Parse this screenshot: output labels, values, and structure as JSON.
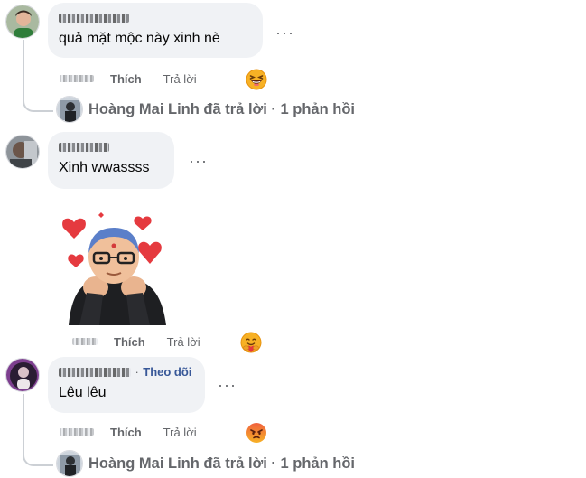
{
  "comments": [
    {
      "text": "quả mặt mộc này xinh nè",
      "more": "···",
      "like_label": "Thích",
      "reply_label": "Trả lời",
      "reaction_icon": "grinning-squint-emoji",
      "replies": {
        "author": "Hoàng Mai Linh",
        "summary": "đã trả lời · 1 phản hồi"
      }
    },
    {
      "text": "Xinh wwassss",
      "more": "···",
      "sticker": "bald-man-with-hearts-sticker",
      "like_label": "Thích",
      "reply_label": "Trả lời",
      "reaction_icon": "hugging-heart-emoji"
    },
    {
      "follow_label": "Theo dõi",
      "follow_sep": "·",
      "text": "Lêu lêu",
      "more": "···",
      "like_label": "Thích",
      "reply_label": "Trả lời",
      "reaction_icon": "angry-face-emoji",
      "replies": {
        "author": "Hoàng Mai Linh",
        "summary": "đã trả lời · 1 phản hồi"
      }
    }
  ],
  "colors": {
    "bubble": "#f0f2f5",
    "meta": "#65676b",
    "link": "#385898",
    "thread_line": "#ccd0d5"
  }
}
